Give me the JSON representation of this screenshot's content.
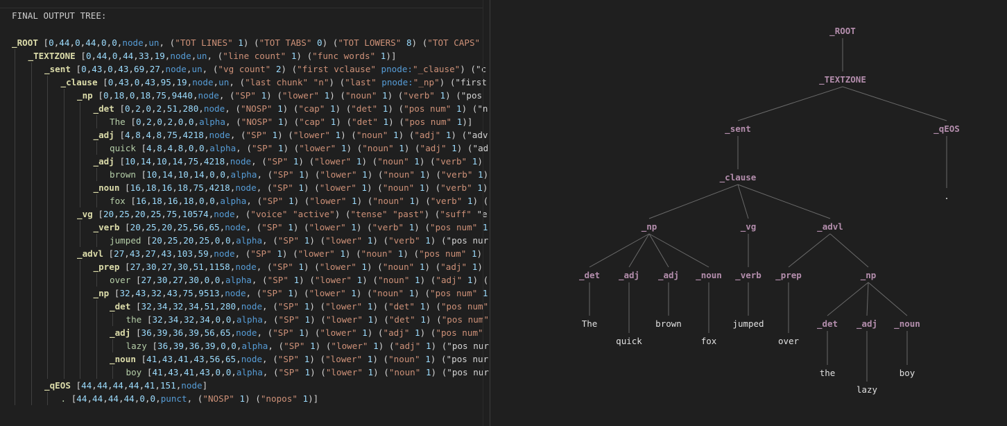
{
  "left": {
    "title": "FINAL OUTPUT TREE:",
    "lines": [
      {
        "depth": 0,
        "label": "_ROOT",
        "kind": "node",
        "range": "[0,44,0,44,0,0,",
        "type": "node",
        "rest": ",un, (\"TOT LINES\" 1) (\"TOT TABS\" 0) (\"TOT LOWERS\" 8) (\"TOT CAPS\""
      },
      {
        "depth": 1,
        "label": "_TEXTZONE",
        "kind": "node",
        "range": "[0,44,0,44,33,19,",
        "type": "node",
        "rest": ",un, (\"line count\" 1) (\"func words\" 1)]"
      },
      {
        "depth": 2,
        "label": "_sent",
        "kind": "node",
        "range": "[0,43,0,43,69,27,",
        "type": "node",
        "rest": ",un, (\"vg count\" 2) (\"first vclause\" pnode:\"_clause\") (\"c"
      },
      {
        "depth": 3,
        "label": "_clause",
        "kind": "node",
        "range": "[0,43,0,43,95,19,",
        "type": "node",
        "rest": ",un, (\"last chunk\" \"n\") (\"last\" pnode:\"_np\") (\"first"
      },
      {
        "depth": 4,
        "label": "_np",
        "kind": "node",
        "range": "[0,18,0,18,75,9440,",
        "type": "node",
        "rest": ", (\"SP\" 1) (\"lower\" 1) (\"noun\" 1) (\"verb\" 1) (\"pos"
      },
      {
        "depth": 5,
        "label": "_det",
        "kind": "node",
        "range": "[0,2,0,2,51,280,",
        "type": "node",
        "rest": ", (\"NOSP\" 1) (\"cap\" 1) (\"det\" 1) (\"pos num\" 1) (\"n"
      },
      {
        "depth": 6,
        "label": "The",
        "kind": "leaf",
        "range": "[0,2,0,2,0,0,",
        "type": "alpha",
        "rest": ", (\"NOSP\" 1) (\"cap\" 1) (\"det\" 1) (\"pos num\" 1)]"
      },
      {
        "depth": 5,
        "label": "_adj",
        "kind": "node",
        "range": "[4,8,4,8,75,4218,",
        "type": "node",
        "rest": ", (\"SP\" 1) (\"lower\" 1) (\"noun\" 1) (\"adj\" 1) (\"adv"
      },
      {
        "depth": 6,
        "label": "quick",
        "kind": "leaf",
        "range": "[4,8,4,8,0,0,",
        "type": "alpha",
        "rest": ", (\"SP\" 1) (\"lower\" 1) (\"noun\" 1) (\"adj\" 1) (\"ad"
      },
      {
        "depth": 5,
        "label": "_adj",
        "kind": "node",
        "range": "[10,14,10,14,75,4218,",
        "type": "node",
        "rest": ", (\"SP\" 1) (\"lower\" 1) (\"noun\" 1) (\"verb\" 1)"
      },
      {
        "depth": 6,
        "label": "brown",
        "kind": "leaf",
        "range": "[10,14,10,14,0,0,",
        "type": "alpha",
        "rest": ", (\"SP\" 1) (\"lower\" 1) (\"noun\" 1) (\"verb\" 1)"
      },
      {
        "depth": 5,
        "label": "_noun",
        "kind": "node",
        "range": "[16,18,16,18,75,4218,",
        "type": "node",
        "rest": ", (\"SP\" 1) (\"lower\" 1) (\"noun\" 1) (\"verb\" 1)"
      },
      {
        "depth": 6,
        "label": "fox",
        "kind": "leaf",
        "range": "[16,18,16,18,0,0,",
        "type": "alpha",
        "rest": ", (\"SP\" 1) (\"lower\" 1) (\"noun\" 1) (\"verb\" 1) ("
      },
      {
        "depth": 4,
        "label": "_vg",
        "kind": "node",
        "range": "[20,25,20,25,75,10574,",
        "type": "node",
        "rest": ", (\"voice\" \"active\") (\"tense\" \"past\") (\"suff\" \"e"
      },
      {
        "depth": 5,
        "label": "_verb",
        "kind": "node",
        "range": "[20,25,20,25,56,65,",
        "type": "node",
        "rest": ", (\"SP\" 1) (\"lower\" 1) (\"verb\" 1) (\"pos num\" 1"
      },
      {
        "depth": 6,
        "label": "jumped",
        "kind": "leaf",
        "range": "[20,25,20,25,0,0,",
        "type": "alpha",
        "rest": ", (\"SP\" 1) (\"lower\" 1) (\"verb\" 1) (\"pos nur"
      },
      {
        "depth": 4,
        "label": "_advl",
        "kind": "node",
        "range": "[27,43,27,43,103,59,",
        "type": "node",
        "rest": ", (\"SP\" 1) (\"lower\" 1) (\"noun\" 1) (\"pos num\" 1)"
      },
      {
        "depth": 5,
        "label": "_prep",
        "kind": "node",
        "range": "[27,30,27,30,51,1158,",
        "type": "node",
        "rest": ", (\"SP\" 1) (\"lower\" 1) (\"noun\" 1) (\"adj\" 1)"
      },
      {
        "depth": 6,
        "label": "over",
        "kind": "leaf",
        "range": "[27,30,27,30,0,0,",
        "type": "alpha",
        "rest": ", (\"SP\" 1) (\"lower\" 1) (\"noun\" 1) (\"adj\" 1) ("
      },
      {
        "depth": 5,
        "label": "_np",
        "kind": "node",
        "range": "[32,43,32,43,75,9513,",
        "type": "node",
        "rest": ", (\"SP\" 1) (\"lower\" 1) (\"noun\" 1) (\"pos num\" 1"
      },
      {
        "depth": 6,
        "label": "_det",
        "kind": "node",
        "range": "[32,34,32,34,51,280,",
        "type": "node",
        "rest": ", (\"SP\" 1) (\"lower\" 1) (\"det\" 1) (\"pos num\""
      },
      {
        "depth": 7,
        "label": "the",
        "kind": "leaf",
        "range": "[32,34,32,34,0,0,",
        "type": "alpha",
        "rest": ", (\"SP\" 1) (\"lower\" 1) (\"det\" 1) (\"pos num\""
      },
      {
        "depth": 6,
        "label": "_adj",
        "kind": "node",
        "range": "[36,39,36,39,56,65,",
        "type": "node",
        "rest": ", (\"SP\" 1) (\"lower\" 1) (\"adj\" 1) (\"pos num\""
      },
      {
        "depth": 7,
        "label": "lazy",
        "kind": "leaf",
        "range": "[36,39,36,39,0,0,",
        "type": "alpha",
        "rest": ", (\"SP\" 1) (\"lower\" 1) (\"adj\" 1) (\"pos nur"
      },
      {
        "depth": 6,
        "label": "_noun",
        "kind": "node",
        "range": "[41,43,41,43,56,65,",
        "type": "node",
        "rest": ", (\"SP\" 1) (\"lower\" 1) (\"noun\" 1) (\"pos nur"
      },
      {
        "depth": 7,
        "label": "boy",
        "kind": "leaf",
        "range": "[41,43,41,43,0,0,",
        "type": "alpha",
        "rest": ", (\"SP\" 1) (\"lower\" 1) (\"noun\" 1) (\"pos nur"
      },
      {
        "depth": 2,
        "label": "_qEOS",
        "kind": "node",
        "range": "[44,44,44,44,41,151,",
        "type": "node",
        "rest": "]"
      },
      {
        "depth": 3,
        "label": ".",
        "kind": "leaf",
        "range": "[44,44,44,44,0,0,",
        "type": "punct",
        "rest": ", (\"NOSP\" 1) (\"nopos\" 1)]"
      }
    ]
  },
  "tree": {
    "nodes": [
      {
        "id": "root",
        "label": "_ROOT",
        "kind": "node"
      },
      {
        "id": "textzone",
        "label": "_TEXTZONE",
        "kind": "node",
        "parent": "root"
      },
      {
        "id": "sent",
        "label": "_sent",
        "kind": "node",
        "parent": "textzone"
      },
      {
        "id": "qeos",
        "label": "_qEOS",
        "kind": "node",
        "parent": "textzone"
      },
      {
        "id": "clause",
        "label": "_clause",
        "kind": "node",
        "parent": "sent"
      },
      {
        "id": "period",
        "label": ".",
        "kind": "leaf",
        "parent": "qeos"
      },
      {
        "id": "np1",
        "label": "_np",
        "kind": "node",
        "parent": "clause"
      },
      {
        "id": "vg",
        "label": "_vg",
        "kind": "node",
        "parent": "clause"
      },
      {
        "id": "advl",
        "label": "_advl",
        "kind": "node",
        "parent": "clause"
      },
      {
        "id": "det1",
        "label": "_det",
        "kind": "node",
        "parent": "np1"
      },
      {
        "id": "adj1",
        "label": "_adj",
        "kind": "node",
        "parent": "np1"
      },
      {
        "id": "adj2",
        "label": "_adj",
        "kind": "node",
        "parent": "np1"
      },
      {
        "id": "noun1",
        "label": "_noun",
        "kind": "node",
        "parent": "np1"
      },
      {
        "id": "verb",
        "label": "_verb",
        "kind": "node",
        "parent": "vg"
      },
      {
        "id": "prep",
        "label": "_prep",
        "kind": "node",
        "parent": "advl"
      },
      {
        "id": "np2",
        "label": "_np",
        "kind": "node",
        "parent": "advl"
      },
      {
        "id": "the1",
        "label": "The",
        "kind": "leaf",
        "parent": "det1"
      },
      {
        "id": "quick",
        "label": "quick",
        "kind": "leaf",
        "parent": "adj1"
      },
      {
        "id": "brown",
        "label": "brown",
        "kind": "leaf",
        "parent": "adj2"
      },
      {
        "id": "fox",
        "label": "fox",
        "kind": "leaf",
        "parent": "noun1"
      },
      {
        "id": "jumped",
        "label": "jumped",
        "kind": "leaf",
        "parent": "verb"
      },
      {
        "id": "over",
        "label": "over",
        "kind": "leaf",
        "parent": "prep"
      },
      {
        "id": "det2",
        "label": "_det",
        "kind": "node",
        "parent": "np2"
      },
      {
        "id": "adj3",
        "label": "_adj",
        "kind": "node",
        "parent": "np2"
      },
      {
        "id": "noun2",
        "label": "_noun",
        "kind": "node",
        "parent": "np2"
      },
      {
        "id": "the2",
        "label": "the",
        "kind": "leaf",
        "parent": "det2"
      },
      {
        "id": "lazy",
        "label": "lazy",
        "kind": "leaf",
        "parent": "adj3"
      },
      {
        "id": "boy",
        "label": "boy",
        "kind": "leaf",
        "parent": "noun2"
      }
    ]
  },
  "colors": {
    "node_label": "#b48ead",
    "leaf_label": "#e0e0e0",
    "edge": "#6a6a6a",
    "code_label": "#dcdcaa",
    "code_number": "#9cdcfe",
    "code_keyword": "#569cd6",
    "code_string": "#ce9178"
  }
}
